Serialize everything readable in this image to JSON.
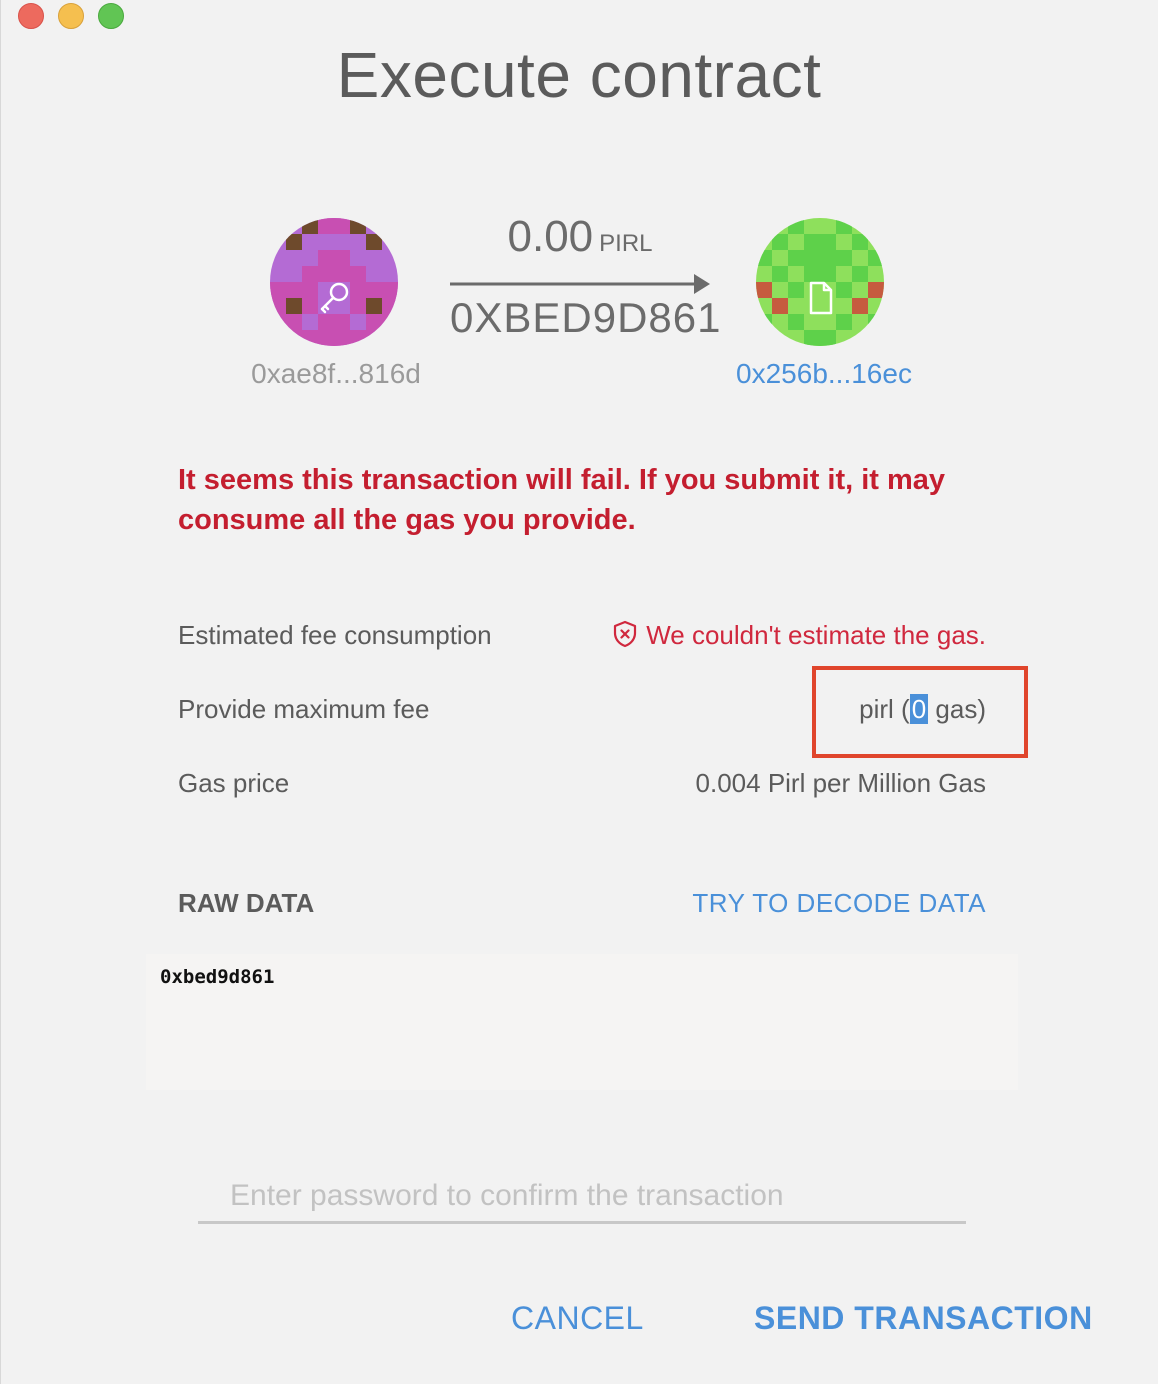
{
  "window": {
    "title": "Execute contract"
  },
  "transfer": {
    "from_address": "0xae8f...816d",
    "to_address": "0x256b...16ec",
    "amount": "0.00",
    "unit": "PIRL",
    "method": "0XBED9D861"
  },
  "warning": "It seems this transaction will fail. If you submit it, it may consume all the gas you provide.",
  "fee": {
    "estimated_label": "Estimated fee consumption",
    "estimated_value": "We couldn't estimate the gas.",
    "max_label": "Provide maximum fee",
    "max_prefix": "pirl (",
    "max_gas": "0",
    "max_suffix": " gas)",
    "gas_price_label": "Gas price",
    "gas_price_value": "0.004 Pirl per Million Gas"
  },
  "raw": {
    "label": "RAW DATA",
    "decode_link": "TRY TO DECODE DATA",
    "data": "0xbed9d861"
  },
  "password": {
    "placeholder": "Enter password to confirm the transaction"
  },
  "buttons": {
    "cancel": "CANCEL",
    "send": "SEND TRANSACTION"
  },
  "colors": {
    "accent": "#4a90d9",
    "error": "#c41e2f",
    "highlight_box": "#e0452c"
  },
  "icons": {
    "from": "key-icon",
    "to": "contract-document-icon",
    "error": "shield-error-icon"
  }
}
